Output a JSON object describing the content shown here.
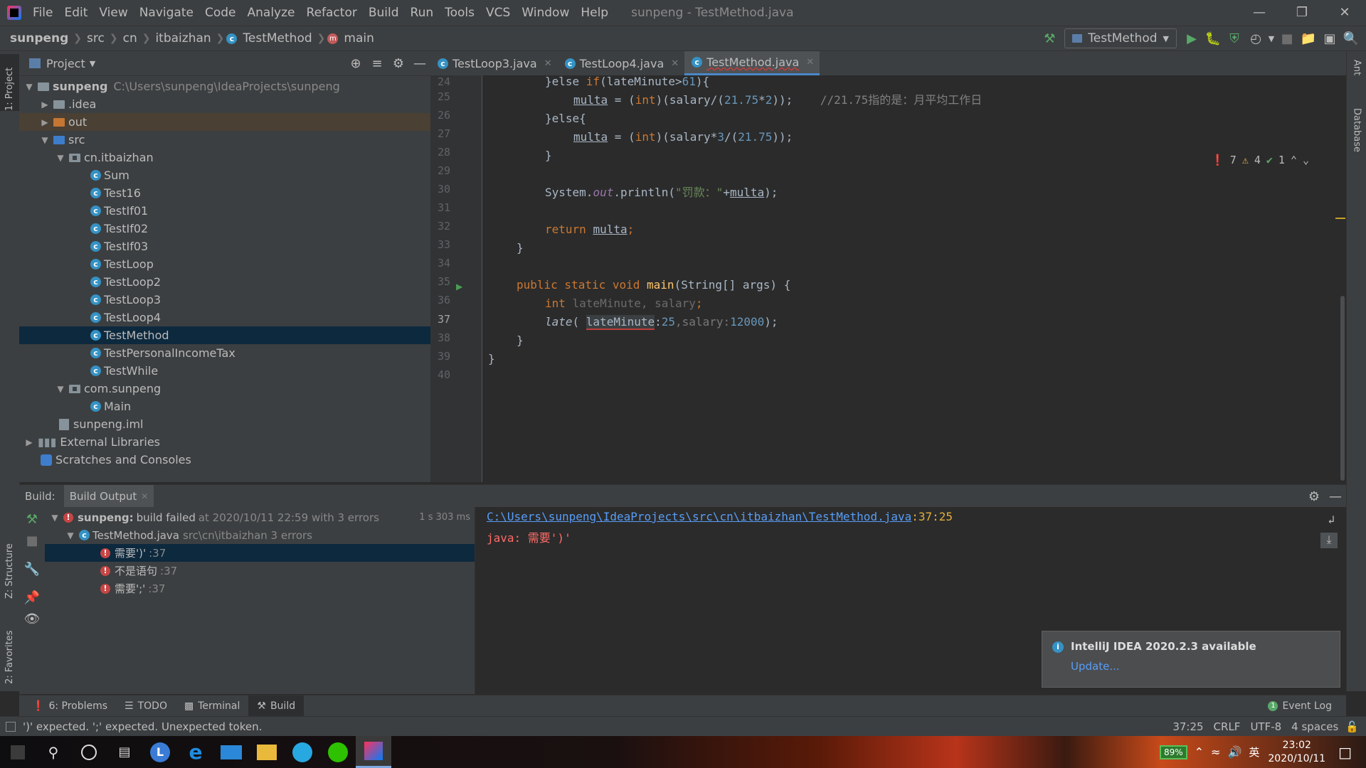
{
  "menu": {
    "items": [
      "File",
      "Edit",
      "View",
      "Navigate",
      "Code",
      "Analyze",
      "Refactor",
      "Build",
      "Run",
      "Tools",
      "VCS",
      "Window",
      "Help"
    ],
    "title": "sunpeng - TestMethod.java"
  },
  "breadcrumb": [
    "sunpeng",
    "src",
    "cn",
    "itbaizhan",
    "TestMethod",
    "main"
  ],
  "run_config": "TestMethod",
  "project_panel": {
    "title": "Project",
    "root_name": "sunpeng",
    "root_path": "C:\\Users\\sunpeng\\IdeaProjects\\sunpeng",
    "items": [
      ".idea",
      "out",
      "src",
      "cn.itbaizhan",
      "Sum",
      "Test16",
      "TestIf01",
      "TestIf02",
      "TestIf03",
      "TestLoop",
      "TestLoop2",
      "TestLoop3",
      "TestLoop4",
      "TestMethod",
      "TestPersonalIncomeTax",
      "TestWhile",
      "com.sunpeng",
      "Main",
      "sunpeng.iml",
      "External Libraries",
      "Scratches and Consoles"
    ]
  },
  "editor": {
    "tabs": [
      "TestLoop3.java",
      "TestLoop4.java",
      "TestMethod.java"
    ],
    "line_numbers": [
      "24",
      "25",
      "26",
      "27",
      "28",
      "29",
      "30",
      "31",
      "32",
      "33",
      "34",
      "35",
      "36",
      "37",
      "38",
      "39",
      "40"
    ],
    "inspections": {
      "errors": "7",
      "warnings": "4",
      "ok": "1"
    },
    "code": {
      "l24a": "}else ",
      "l24b": "if",
      "l24c": "(lateMinute>",
      "l24d": "61",
      "l24e": "){",
      "l25a": "multa",
      "l25b": " = (",
      "l25c": "int",
      "l25d": ")(salary/(",
      "l25e": "21.75",
      "l25f": "*",
      "l25g": "2",
      "l25h": "));",
      "l25i": "    //21.75指的是：月平均工作日",
      "l26a": "}else{",
      "l27a": "multa",
      "l27b": " = (",
      "l27c": "int",
      "l27d": ")(salary*",
      "l27e": "3",
      "l27f": "/(",
      "l27g": "21.75",
      "l27h": "));",
      "l28a": "}",
      "l30a": "System.",
      "l30b": "out",
      "l30c": ".println(",
      "l30d": "\"罚款：\"",
      "l30e": "+",
      "l30f": "multa",
      "l30g": ");",
      "l32a": "return ",
      "l32b": "multa",
      "l32c": ";",
      "l33a": "}",
      "l35a": "public static void ",
      "l35b": "main",
      "l35c": "(String[] args) {",
      "l36a": "int ",
      "l36b": "lateMinute",
      "l36c": ", salary",
      "l36d": ";",
      "l37a": "late",
      "l37b": "( ",
      "l37c": "lateMinute",
      "l37d": ":",
      "l37e": "25",
      "l37f": ",salary:",
      "l37g": "12000",
      "l37h": ");",
      "l38a": "}",
      "l39a": "}"
    }
  },
  "build": {
    "label": "Build:",
    "tab": "Build Output",
    "result_project": "sunpeng:",
    "result_text": "build failed",
    "result_time": "at 2020/10/11 22:59 with 3 errors",
    "duration": "1 s 303 ms",
    "file": "TestMethod.java",
    "file_detail": "src\\cn\\itbaizhan 3 errors",
    "errors": [
      {
        "msg": "需要')'",
        "line": ":37"
      },
      {
        "msg": "不是语句",
        "line": ":37"
      },
      {
        "msg": "需要';'",
        "line": ":37"
      }
    ],
    "output_path": "C:\\Users\\sunpeng\\IdeaProjects\\src\\cn\\itbaizhan\\TestMethod.java",
    "output_pos": ":37:25",
    "output_msg": "java: 需要')'"
  },
  "notification": {
    "title": "IntelliJ IDEA 2020.2.3 available",
    "link": "Update..."
  },
  "tool_windows": [
    "6: Problems",
    "TODO",
    "Terminal",
    "Build"
  ],
  "event_log": "Event Log",
  "status": {
    "message": "')' expected. ';' expected. Unexpected token.",
    "position": "37:25",
    "line_sep": "CRLF",
    "encoding": "UTF-8",
    "indent": "4 spaces"
  },
  "side_labels": {
    "project": "1: Project",
    "structure": "Z: Structure",
    "favorites": "2: Favorites",
    "ant": "Ant",
    "database": "Database"
  },
  "taskbar": {
    "battery": "89%",
    "ime": "英",
    "time": "23:02",
    "date": "2020/10/11"
  }
}
